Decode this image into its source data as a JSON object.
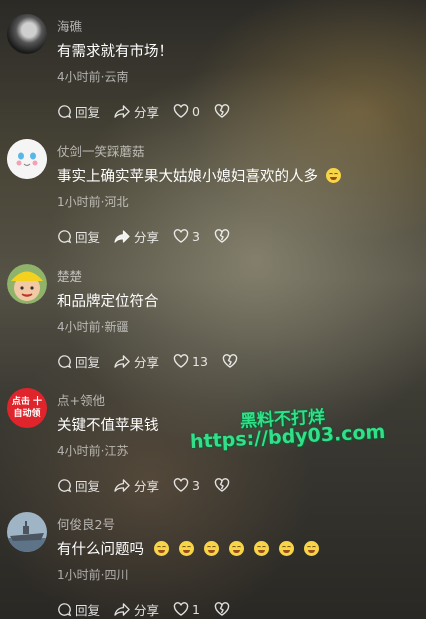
{
  "comments": [
    {
      "username": "海礁",
      "text": "有需求就有市场！",
      "emojis": [],
      "meta": "4小时前·云南",
      "reply_label": "回复",
      "share_label": "分享",
      "likes": "0",
      "avatar": "dark-portrait-avatar"
    },
    {
      "username": "仗剑一笑踩蘑菇",
      "text": "事实上确实苹果大姑娘小媳妇喜欢的人多",
      "emojis": [
        "grin-emoji"
      ],
      "meta": "1小时前·河北",
      "reply_label": "回复",
      "share_label": "分享",
      "likes": "3",
      "avatar": "cartoon-face-avatar"
    },
    {
      "username": "楚楚",
      "text": "和品牌定位符合",
      "emojis": [],
      "meta": "4小时前·新疆",
      "reply_label": "回复",
      "share_label": "分享",
      "likes": "13",
      "avatar": "child-yellow-hat-avatar"
    },
    {
      "username": "点+领他",
      "text": "关键不值苹果钱",
      "emojis": [],
      "meta": "4小时前·江苏",
      "reply_label": "回复",
      "share_label": "分享",
      "likes": "3",
      "avatar": "red-badge-avatar",
      "avatar_text": [
        "点击 十",
        "自动领"
      ]
    },
    {
      "username": "何俊良2号",
      "text": "有什么问题吗",
      "emojis": [
        "grin-emoji",
        "grin-emoji",
        "grin-emoji",
        "grin-emoji",
        "grin-emoji",
        "grin-emoji",
        "grin-emoji"
      ],
      "meta": "1小时前·四川",
      "reply_label": "回复",
      "share_label": "分享",
      "likes": "1",
      "avatar": "warship-avatar"
    }
  ],
  "watermark": {
    "line1": "黑料不打烊",
    "line2": "https://bdy03.com"
  },
  "colors": {
    "watermark": "#32e08a",
    "emoji": "#f7d548",
    "badge_red": "#e0242c"
  }
}
